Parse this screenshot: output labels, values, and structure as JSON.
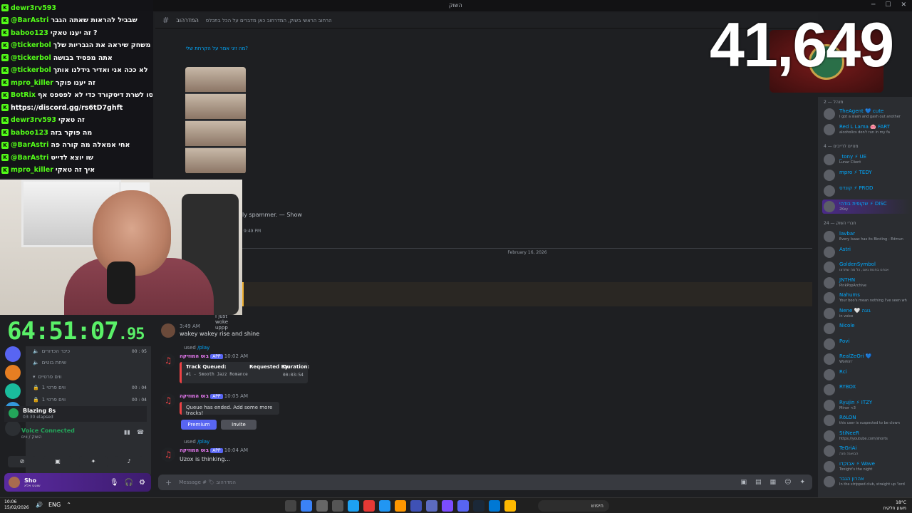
{
  "window": {
    "title": "השוק"
  },
  "header": {
    "channel": "המדרהוב",
    "topic": "הרחוב הראשי בשוק, המדרחוב כאן מדברים על הכל בתכלס"
  },
  "overlay_chat": [
    {
      "user": "dewr3rv593",
      "msg": "",
      "user_color": "#53fc18"
    },
    {
      "user": "@BarAstri",
      "msg": "שבביל להראות שאתה הגבר",
      "user_color": "#53fc18"
    },
    {
      "user": "baboo123",
      "msg": "זה יענו טאקי ?",
      "user_color": "#53fc18"
    },
    {
      "user": "@tickerbol",
      "msg": "שו אתה צריך משחק שיראה את הגבריות שלך",
      "user_color": "#53fc18"
    },
    {
      "user": "@tickerbol",
      "msg": "אתה מפסיד בבושה",
      "user_color": "#53fc18"
    },
    {
      "user": "@tickerbol",
      "msg": "לא ככה אני ואדיר גידלנו אותך",
      "user_color": "#53fc18"
    },
    {
      "user": "mpro_killer",
      "msg": "זה יענו פוקר",
      "user_color": "#53fc18"
    },
    {
      "user": "BotRix",
      "msg": "אם אתם נהנים מהשידורים כנסו לשרת דיסקורד כדי לא לפספס אף",
      "user_color": "#53fc18"
    },
    {
      "user": "",
      "msg": "https://discord.gg/rs6tD7ghft",
      "user_color": "#53fc18"
    },
    {
      "user": "dewr3rv593",
      "msg": "זה טאקי",
      "user_color": "#53fc18"
    },
    {
      "user": "baboo123",
      "msg": "מה פוקר בזה",
      "user_color": "#53fc18"
    },
    {
      "user": "@BarAstri",
      "msg": "אחי אמאלה מה קורה פה",
      "user_color": "#53fc18"
    },
    {
      "user": "@BarAstri",
      "msg": "שו יוצא לדייט",
      "user_color": "#53fc18"
    },
    {
      "user": "mpro_killer",
      "msg": "איך זה טאקי",
      "user_color": "#53fc18"
    }
  ],
  "reply_quote": "מה זיגי אמר על הקרחת שלי?",
  "spam_note": "ly spammer. — Show",
  "spam_time": "9:49 PM",
  "stream_counter": "41,649",
  "stream_timer": {
    "main": "64:51:07",
    "fraction": ".95"
  },
  "date_divider": "February 16, 2026",
  "messages": [
    {
      "head": "I just woke uppp",
      "time": "3:49 AM",
      "text": "wakey wakey rise and shine"
    },
    {
      "used_by": "used",
      "command": "/play",
      "bot": "בוט המוזיקה",
      "app": "APP",
      "time": "10:02 AM"
    },
    {
      "used_by": "used",
      "command": "/play",
      "bot": "בוט המוזיקה",
      "app": "APP",
      "time": "10:04 AM",
      "thinking": "Uzox is thinking..."
    }
  ],
  "embed_track": {
    "title": "Track Queued:",
    "track": "#1 - Smooth Jazz Romance",
    "requested_label": "Requested By:",
    "duration_label": "Duration:",
    "duration": "00:03:54"
  },
  "bot_msg2_time": "10:05 AM",
  "embed_queue": {
    "text": "Queue has ended. Add some more tracks!"
  },
  "buttons": {
    "premium": "Premium",
    "invite": "Invite"
  },
  "composer": {
    "placeholder": "Message # 🏷 המדרהוב"
  },
  "channels": [
    {
      "name": "כיכר הכדורים",
      "time": "00 : 05"
    },
    {
      "name": "שיחת בוטים",
      "time": ""
    },
    {
      "name": "ווים פרטיים",
      "time": ""
    },
    {
      "name": "ווים פרטי 1",
      "time": "00 : 04"
    },
    {
      "name": "ווים פרטי 1",
      "time": "00 : 04"
    }
  ],
  "now_playing": {
    "title": "Blazing 8s",
    "sub": "03:30 elapsed"
  },
  "voice": {
    "status": "Voice Connected",
    "channel": "השוק / ווים"
  },
  "user_panel": {
    "name": "Sho",
    "status": "שוטט אלא"
  },
  "members": {
    "cat_mod": "מנהל — 2",
    "mods": [
      {
        "name": "TheAgent 💙 cute",
        "status": "I got a slash and gash out another"
      },
      {
        "name": "Red L Lama 🐽 FART",
        "status": "alcoholics don't run in my fa"
      }
    ],
    "cat_streamers": "מנויים לרייבים — 4",
    "streamers": [
      {
        "name": "_tony ⚡ UE",
        "status": "Lunar Client"
      },
      {
        "name": "mpro ⚡ TEDY",
        "status": ""
      },
      {
        "name": "קונדס ⚡ PROD",
        "status": ""
      },
      {
        "name": "שקופית בודהי ⚡ DISC",
        "status": "2Key"
      }
    ],
    "cat_members": "חברי השוק — 24",
    "people": [
      {
        "name": "lavbar",
        "status": "Every Isaac has its Binding - Edmun"
      },
      {
        "name": "Astri",
        "status": ""
      },
      {
        "name": "GoldenSymbol",
        "status": "אנחנו בחנות גאגו, כל מה שתרצו"
      },
      {
        "name": "JNTHN",
        "status": "PinkPopArchive"
      },
      {
        "name": "Nahums",
        "status": "Your boo's mean nothing I've seen wh"
      },
      {
        "name": "Nene 🤍 גוגה",
        "status": "in voice"
      },
      {
        "name": "Nicole",
        "status": ""
      },
      {
        "name": "Povi",
        "status": ""
      },
      {
        "name": "RealZeOri 💙",
        "status": "Workin'"
      },
      {
        "name": "Rci",
        "status": ""
      },
      {
        "name": "RYBOX",
        "status": ""
      },
      {
        "name": "Ryujin ⚡ ITZY",
        "status": "Minor <3"
      },
      {
        "name": "RōLON",
        "status": "this user is suspected to be clown"
      },
      {
        "name": "StiNeeR",
        "status": "https://youtube.com/shorts"
      },
      {
        "name": "TeGriAi",
        "status": "הבואגה מגה"
      },
      {
        "name": "אבוקדו ⚡ Wave",
        "status": "Tonight's the night"
      },
      {
        "name": "אהרון הגבר",
        "status": "In the stripped club, straight up 'lord"
      }
    ]
  },
  "taskbar": {
    "time": "10:06",
    "date": "15/02/2026",
    "lang": "ENG",
    "search": "חיפוש",
    "weather": "18°C",
    "weather_desc": "מעונן חלקית"
  },
  "colors": {
    "accent": "#5865f2",
    "chat_user": "#53fc18",
    "timer": "#5af068",
    "link": "#00a8fc"
  }
}
